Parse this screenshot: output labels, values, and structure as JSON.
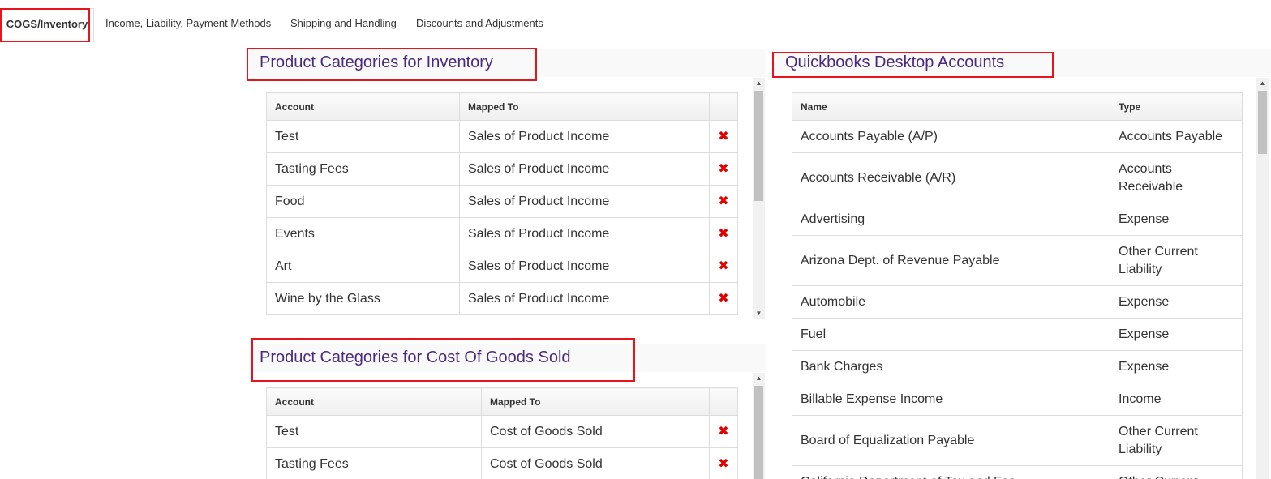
{
  "tabs": [
    {
      "label": "COGS/Inventory"
    },
    {
      "label": "Income, Liability, Payment Methods"
    },
    {
      "label": "Shipping and Handling"
    },
    {
      "label": "Discounts and Adjustments"
    }
  ],
  "inventory": {
    "title": "Product Categories for Inventory",
    "headers": {
      "account": "Account",
      "mapped": "Mapped To"
    },
    "rows": [
      {
        "account": "Test",
        "mapped": "Sales of Product Income"
      },
      {
        "account": "Tasting Fees",
        "mapped": "Sales of Product Income"
      },
      {
        "account": "Food",
        "mapped": "Sales of Product Income"
      },
      {
        "account": "Events",
        "mapped": "Sales of Product Income"
      },
      {
        "account": "Art",
        "mapped": "Sales of Product Income"
      },
      {
        "account": "Wine by the Glass",
        "mapped": "Sales of Product Income"
      }
    ]
  },
  "cogs": {
    "title": "Product Categories for Cost Of Goods Sold",
    "headers": {
      "account": "Account",
      "mapped": "Mapped To"
    },
    "rows": [
      {
        "account": "Test",
        "mapped": "Cost of Goods Sold"
      },
      {
        "account": "Tasting Fees",
        "mapped": "Cost of Goods Sold"
      }
    ]
  },
  "qb": {
    "title": "Quickbooks Desktop Accounts",
    "headers": {
      "name": "Name",
      "type": "Type"
    },
    "rows": [
      {
        "name": "Accounts Payable (A/P)",
        "type": "Accounts Payable"
      },
      {
        "name": "Accounts Receivable (A/R)",
        "type": "Accounts Receivable"
      },
      {
        "name": "Advertising",
        "type": "Expense"
      },
      {
        "name": "Arizona Dept. of Revenue Payable",
        "type": "Other Current Liability"
      },
      {
        "name": "Automobile",
        "type": "Expense"
      },
      {
        "name": "Fuel",
        "type": "Expense"
      },
      {
        "name": "Bank Charges",
        "type": "Expense"
      },
      {
        "name": "Billable Expense Income",
        "type": "Income"
      },
      {
        "name": "Board of Equalization Payable",
        "type": "Other Current Liability"
      },
      {
        "name": "California Department of Tax and Fee",
        "type": "Other Current"
      }
    ]
  },
  "icons": {
    "delete": "✖"
  },
  "colors": {
    "title": "#4a2a7d",
    "delete": "#e00000",
    "highlight": "#e8141b"
  }
}
